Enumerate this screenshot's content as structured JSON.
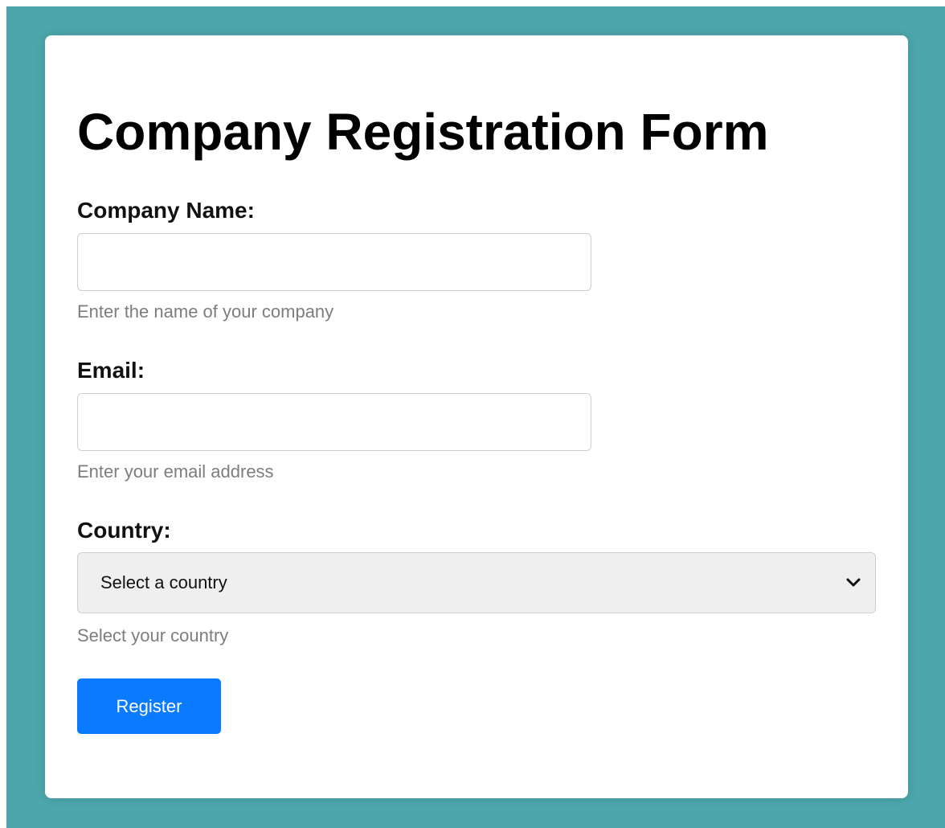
{
  "form": {
    "title": "Company Registration Form",
    "company_name": {
      "label": "Company Name:",
      "value": "",
      "placeholder": "",
      "hint": "Enter the name of your company"
    },
    "email": {
      "label": "Email:",
      "value": "",
      "placeholder": "",
      "hint": "Enter your email address"
    },
    "country": {
      "label": "Country:",
      "selected": "Select a country",
      "hint": "Select your country"
    },
    "submit_label": "Register"
  },
  "colors": {
    "background": "#4ca6ab",
    "card": "#ffffff",
    "button": "#0a7bff",
    "hint_text": "#7d7d7d"
  },
  "icons": {
    "select_arrow": "chevron-down-icon"
  }
}
